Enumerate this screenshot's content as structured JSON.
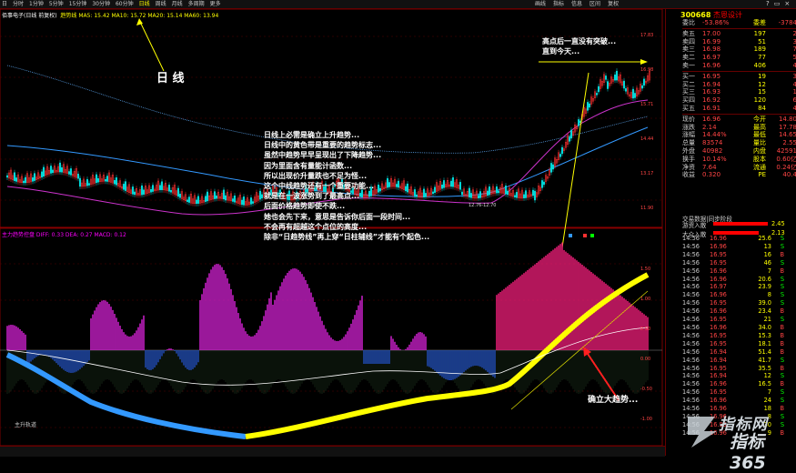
{
  "toolbar": {
    "menu": [
      "日",
      "分时",
      "1分钟",
      "5分钟",
      "15分钟",
      "30分钟",
      "60分钟",
      "日线",
      "周线",
      "月线",
      "多周期",
      "更多"
    ],
    "right": [
      "画线",
      "指标",
      "信息",
      "区间",
      "复权"
    ],
    "window": [
      "?",
      "▭",
      "×"
    ]
  },
  "legend": {
    "name": "佰事电子(日线 前复权)",
    "item1": "趋势线 MA5: 15.42 MA10: 15.72 MA20: 15.14 MA60: 13.94",
    "osc": "主力趋势控盘 DIFF: 0.33 DEA: 0.27 MACD: 0.12"
  },
  "annotations": {
    "daily": "日 线",
    "top_note": [
      "高点后一直没有突破...",
      "直到今天..."
    ],
    "main_note": [
      "日线上必需是确立上升趋势...",
      "日线中的黄色带是重要的趋势标志...",
      "虽然中趋势早早呈现出了下降趋势...",
      "因为里面含有量能计函数...",
      "所以出现价升量跌也不足为怪...",
      "这个中线趋势还有一个重要功能...",
      "就是在一波涨势到了最高点...",
      "后面价格趋势即使不跌...",
      "她也会先下来，意思是告诉你后面一段时间...",
      "不会再有超越这个点位的高度...",
      "除非“日趋势线”再上穿“日柱辅线”才能有个起色..."
    ],
    "trend": "确立大趋势...",
    "price_low": "12.76-12.70",
    "osc_title": "主力趋势控盘",
    "bottom_label": "主升轨道"
  },
  "axis": {
    "price_labels": [
      "17.83",
      "16.98",
      "15.71",
      "14.44",
      "13.17",
      "11.90"
    ],
    "osc_labels": [
      "1.50",
      "1.00",
      "0.50",
      "0.00",
      "-0.50",
      "-1.00"
    ]
  },
  "panel": {
    "code": "300668",
    "name": "杰恩设计",
    "rows": [
      {
        "k": "委比",
        "p": "-53.86%",
        "v": "委差",
        "d": "-3784"
      },
      {
        "k": "卖五",
        "p": "17.00",
        "v": "197",
        "d": "2"
      },
      {
        "k": "卖四",
        "p": "16.99",
        "v": "51",
        "d": "3"
      },
      {
        "k": "卖三",
        "p": "16.98",
        "v": "189",
        "d": "7"
      },
      {
        "k": "卖二",
        "p": "16.97",
        "v": "77",
        "d": "5"
      },
      {
        "k": "卖一",
        "p": "16.96",
        "v": "406",
        "d": "4"
      },
      {
        "k": "买一",
        "p": "16.95",
        "v": "19",
        "d": "3"
      },
      {
        "k": "买二",
        "p": "16.94",
        "v": "12",
        "d": "4"
      },
      {
        "k": "买三",
        "p": "16.93",
        "v": "15",
        "d": "1"
      },
      {
        "k": "买四",
        "p": "16.92",
        "v": "120",
        "d": "6"
      },
      {
        "k": "买五",
        "p": "16.91",
        "v": "84",
        "d": "4"
      },
      {
        "k": "现价",
        "p": "16.96",
        "v": "今开",
        "d": "14.80"
      },
      {
        "k": "涨跌",
        "p": "2.14",
        "v": "最高",
        "d": "17.78"
      },
      {
        "k": "涨幅",
        "p": "14.44%",
        "v": "最低",
        "d": "14.65"
      },
      {
        "k": "总量",
        "p": "83574",
        "v": "量比",
        "d": "2.55"
      },
      {
        "k": "外盘",
        "p": "40982",
        "v": "内盘",
        "d": "42591"
      },
      {
        "k": "换手",
        "p": "10.14%",
        "v": "股本",
        "d": "0.60亿"
      },
      {
        "k": "净资",
        "p": "7.64",
        "v": "流通",
        "d": "0.24亿"
      },
      {
        "k": "收益",
        "p": "0.320",
        "v": "PE",
        "d": "40.4"
      }
    ],
    "trade_title": "交易数据|同步阶段",
    "big_buy": {
      "k": "游资入散",
      "v": "2.45"
    },
    "big_sell": {
      "k": "大众入散",
      "v": "2.13"
    },
    "ticks": [
      {
        "t": "14:56",
        "p": "16.96",
        "v": "25.6",
        "s": "S"
      },
      {
        "t": "14:56",
        "p": "16.96",
        "v": "13",
        "s": "S"
      },
      {
        "t": "14:56",
        "p": "16.95",
        "v": "16",
        "s": "B"
      },
      {
        "t": "14:56",
        "p": "16.95",
        "v": "46",
        "s": "S"
      },
      {
        "t": "14:56",
        "p": "16.96",
        "v": "7",
        "s": "B"
      },
      {
        "t": "14:56",
        "p": "16.96",
        "v": "20.6",
        "s": "S"
      },
      {
        "t": "14:56",
        "p": "16.97",
        "v": "23.9",
        "s": "S"
      },
      {
        "t": "14:56",
        "p": "16.96",
        "v": "8",
        "s": "S"
      },
      {
        "t": "14:56",
        "p": "16.95",
        "v": "39.0",
        "s": "S"
      },
      {
        "t": "14:56",
        "p": "16.96",
        "v": "23.4",
        "s": "B"
      },
      {
        "t": "14:56",
        "p": "16.95",
        "v": "21",
        "s": "S"
      },
      {
        "t": "14:56",
        "p": "16.96",
        "v": "34.0",
        "s": "B"
      },
      {
        "t": "14:56",
        "p": "16.95",
        "v": "15.3",
        "s": "B"
      },
      {
        "t": "14:56",
        "p": "16.95",
        "v": "18.1",
        "s": "B"
      },
      {
        "t": "14:56",
        "p": "16.94",
        "v": "51.4",
        "s": "B"
      },
      {
        "t": "14:56",
        "p": "16.94",
        "v": "41.7",
        "s": "S"
      },
      {
        "t": "14:56",
        "p": "16.95",
        "v": "35.5",
        "s": "B"
      },
      {
        "t": "14:56",
        "p": "16.94",
        "v": "12",
        "s": "S"
      },
      {
        "t": "14:56",
        "p": "16.96",
        "v": "16.5",
        "s": "B"
      },
      {
        "t": "14:56",
        "p": "16.95",
        "v": "7",
        "s": "S"
      },
      {
        "t": "14:56",
        "p": "16.96",
        "v": "24",
        "s": "S"
      },
      {
        "t": "14:56",
        "p": "16.96",
        "v": "18",
        "s": "B"
      },
      {
        "t": "14:56",
        "p": "16.96",
        "v": "8",
        "s": "S"
      },
      {
        "t": "14:56",
        "p": "16.95",
        "v": "30",
        "s": "S"
      },
      {
        "t": "14:56",
        "p": "16.96",
        "v": "9",
        "s": "B"
      }
    ]
  },
  "watermark": {
    "line1": "指标网",
    "line2": "指标365"
  },
  "colors": {
    "up": "#ff3030",
    "down": "#00ffff",
    "yellow_band": "#ffff00",
    "magenta": "#ff00ff",
    "blue_band": "#3399ff"
  }
}
